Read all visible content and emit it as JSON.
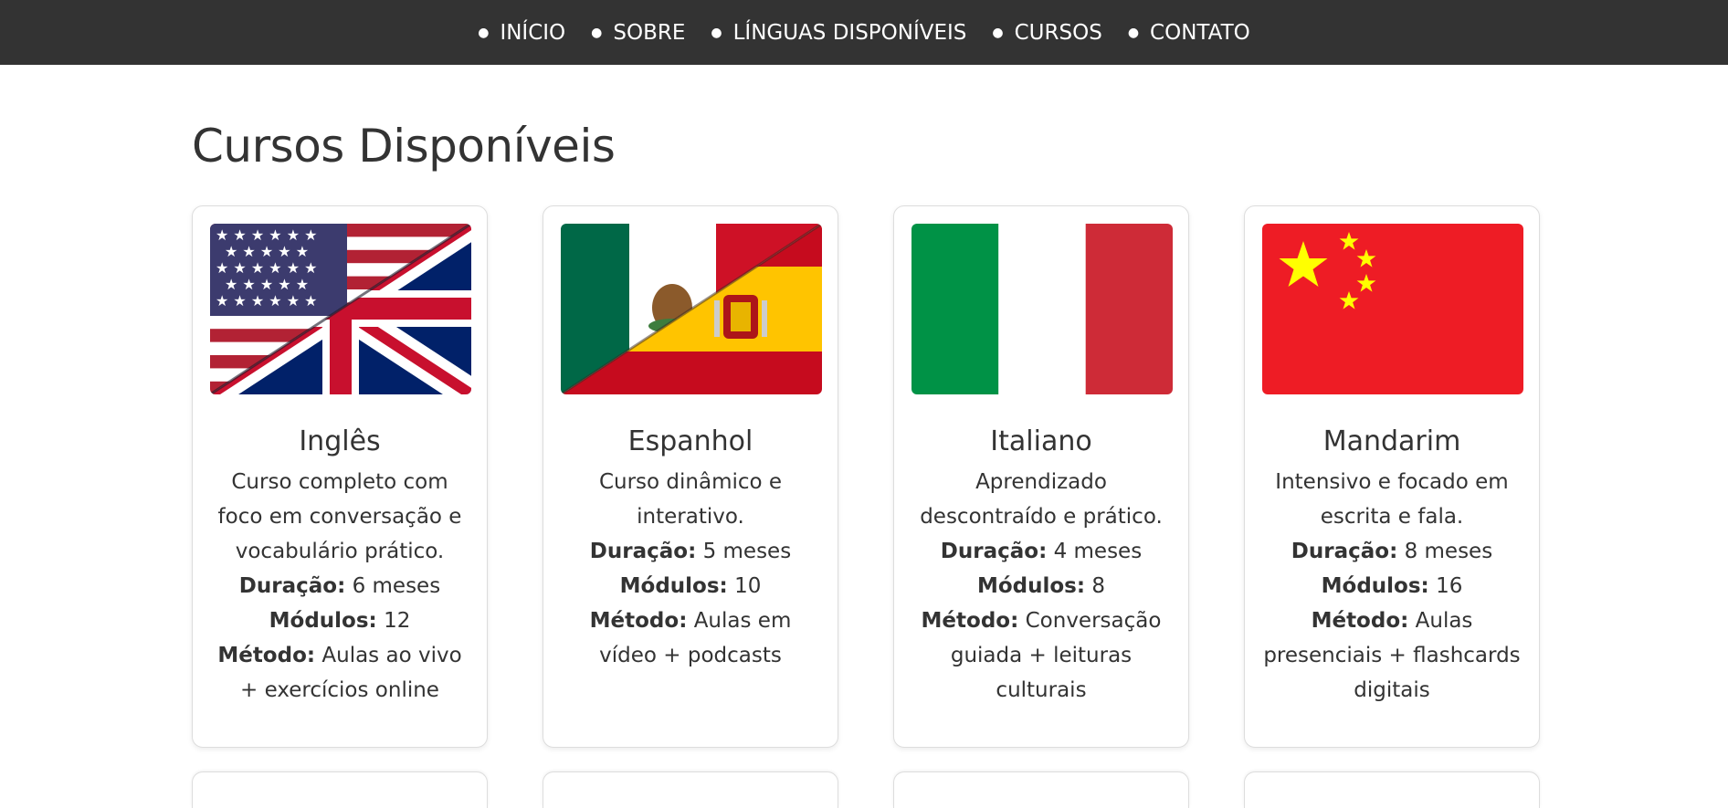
{
  "nav": {
    "items": [
      "INÍCIO",
      "SOBRE",
      "LÍNGUAS DISPONÍVEIS",
      "CURSOS",
      "CONTATO"
    ]
  },
  "page": {
    "title": "Cursos Disponíveis"
  },
  "labels": {
    "duration": "Duração:",
    "modules": "Módulos:",
    "method": "Método:"
  },
  "courses": [
    {
      "name": "Inglês",
      "description": "Curso completo com foco em conversação e vocabulário prático.",
      "duration": "6 meses",
      "modules": "12",
      "method": "Aulas ao vivo + exercícios online",
      "flag_icon": "usa-uk-flag-icon"
    },
    {
      "name": "Espanhol",
      "description": "Curso dinâmico e interativo.",
      "duration": "5 meses",
      "modules": "10",
      "method": "Aulas em vídeo + podcasts",
      "flag_icon": "mexico-spain-flag-icon"
    },
    {
      "name": "Italiano",
      "description": "Aprendizado descontraído e prático.",
      "duration": "4 meses",
      "modules": "8",
      "method": "Conversação guiada + leituras culturais",
      "flag_icon": "italy-flag-icon"
    },
    {
      "name": "Mandarim",
      "description": "Intensivo e focado em escrita e fala.",
      "duration": "8 meses",
      "modules": "16",
      "method": "Aulas presenciais + flashcards digitais",
      "flag_icon": "china-flag-icon"
    }
  ],
  "colors": {
    "nav_bg": "#333333",
    "italy_green": "#009246",
    "italy_red": "#ce2b37",
    "china_red": "#ee1c25",
    "china_star": "#ffff00"
  }
}
